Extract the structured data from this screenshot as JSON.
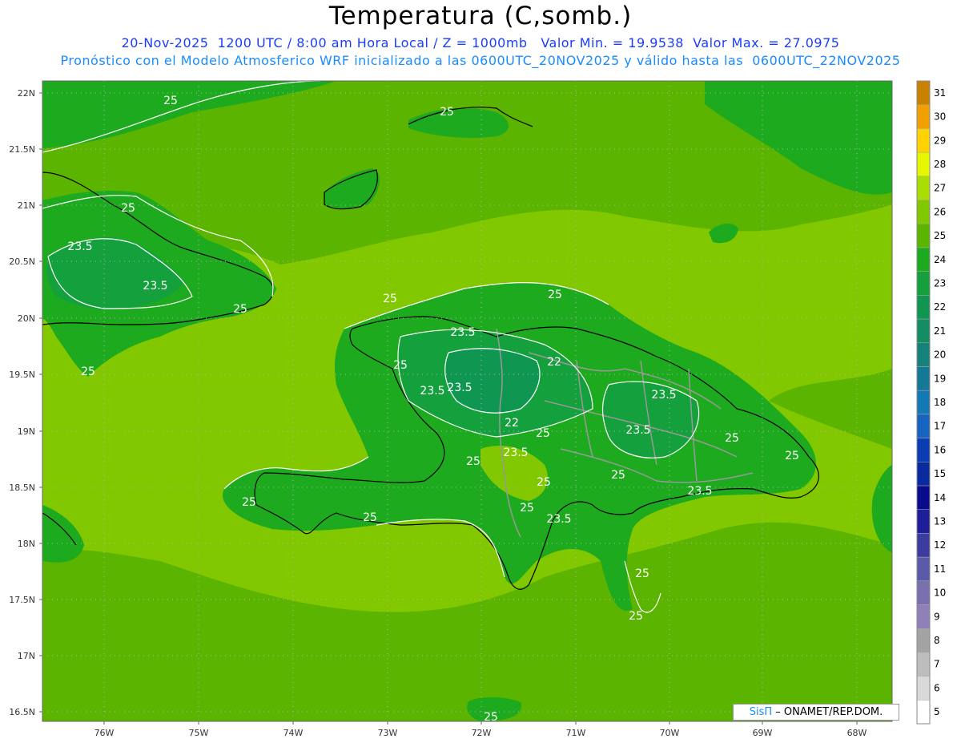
{
  "header": {
    "title": "Temperatura (C,somb.)",
    "line1": "20-Nov-2025  1200 UTC / 8:00 am Hora Local / Z = 1000mb   Valor Min. = 19.9538  Valor Max. = 27.0975",
    "line2": "Pronóstico con el Modelo Atmosferico WRF inicializado a las 0600UTC_20NOV2025 y válido hasta las  0600UTC_22NOV2025"
  },
  "axes": {
    "lat_labels": [
      "22N",
      "21.5N",
      "21N",
      "20.5N",
      "20N",
      "19.5N",
      "19N",
      "18.5N",
      "18N",
      "17.5N",
      "17N",
      "16.5N"
    ],
    "lon_labels": [
      "76W",
      "75W",
      "74W",
      "73W",
      "72W",
      "71W",
      "70W",
      "69W",
      "68W"
    ]
  },
  "colorbar": {
    "levels": [
      "5",
      "6",
      "7",
      "8",
      "9",
      "10",
      "11",
      "12",
      "13",
      "14",
      "15",
      "16",
      "17",
      "18",
      "19",
      "20",
      "21",
      "22",
      "23",
      "24",
      "25",
      "26",
      "27",
      "28",
      "29",
      "30",
      "31"
    ],
    "colors": [
      "#ffffff",
      "#d9d9d9",
      "#bdbdbd",
      "#a3a3a3",
      "#9080b8",
      "#7a70b0",
      "#5a5aa8",
      "#3c3ca0",
      "#1e1e98",
      "#0a0a8c",
      "#0a2aa0",
      "#0a3cb4",
      "#1464c0",
      "#1478b4",
      "#147896",
      "#148278",
      "#148c64",
      "#0f9650",
      "#14a03c",
      "#1eaa1e",
      "#5ab400",
      "#82c800",
      "#aade00",
      "#e6f500",
      "#ffd200",
      "#f0a000",
      "#c88200"
    ]
  },
  "contour_labels": [
    "25",
    "25",
    "25",
    "23.5",
    "23.5",
    "25",
    "25",
    "25",
    "25",
    "23.5",
    "25",
    "23.5",
    "23.5",
    "22",
    "23.5",
    "22",
    "25",
    "23.5",
    "23.5",
    "25",
    "25",
    "25",
    "25",
    "23.5",
    "25",
    "25",
    "25",
    "25",
    "23.5",
    "25",
    "25",
    "25"
  ],
  "credit": {
    "sis": "SisΠ",
    "rest": " – ONAMET/REP.DOM."
  }
}
